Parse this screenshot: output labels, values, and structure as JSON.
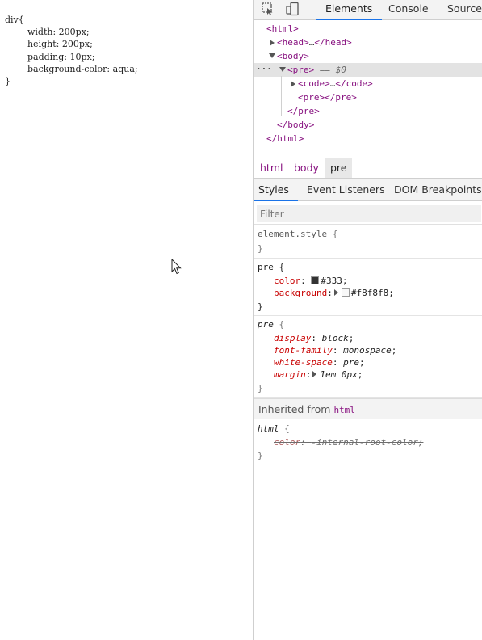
{
  "page": {
    "code_lines": [
      "div{",
      "        width: 200px;",
      "        height: 200px;",
      "        padding: 10px;",
      "        background-color: aqua;",
      "}"
    ]
  },
  "devtools": {
    "tabs": [
      {
        "label": "Elements",
        "active": true
      },
      {
        "label": "Console",
        "active": false
      },
      {
        "label": "Sources",
        "active": false
      }
    ],
    "dom_tree": {
      "html_open": "<html>",
      "head_open": "<head>",
      "head_ellipsis": "…",
      "head_close": "</head>",
      "body_open": "<body>",
      "pre_open": "<pre>",
      "selected_marker": "== $0",
      "code_open": "<code>",
      "code_ellipsis": "…",
      "code_close": "</code>",
      "inner_pre_open": "<pre>",
      "inner_pre_close": "</pre>",
      "pre_close": "</pre>",
      "body_close": "</body>",
      "html_close": "</html>"
    },
    "breadcrumb": [
      {
        "label": "html",
        "active": false
      },
      {
        "label": "body",
        "active": false
      },
      {
        "label": "pre",
        "active": true
      }
    ],
    "style_tabs": [
      {
        "label": "Styles",
        "active": true
      },
      {
        "label": "Event Listeners",
        "active": false
      },
      {
        "label": "DOM Breakpoints",
        "active": false
      }
    ],
    "filter_placeholder": "Filter",
    "rules": {
      "element_style": {
        "selector": "element.style",
        "open": "{",
        "close": "}"
      },
      "pre_author": {
        "selector": "pre",
        "open": "{",
        "close": "}",
        "color_prop": "color",
        "color_val": "#333",
        "color_swatch": "#333333",
        "background_prop": "background",
        "background_val": "#f8f8f8",
        "background_swatch": "#f8f8f8"
      },
      "pre_ua": {
        "selector": "pre",
        "open": "{",
        "close": "}",
        "props": [
          {
            "prop": "display",
            "val": "block"
          },
          {
            "prop": "font-family",
            "val": "monospace"
          },
          {
            "prop": "white-space",
            "val": "pre"
          },
          {
            "prop": "margin",
            "val": "1em 0px"
          }
        ]
      },
      "inherited_label": "Inherited from",
      "inherited_tag": "html",
      "html_ua": {
        "selector": "html",
        "open": "{",
        "close": "}",
        "prop": "color",
        "val": "-internal-root-color"
      }
    },
    "colors": {
      "tag": "#881280",
      "property": "#c80000",
      "accent": "#1a73e8",
      "selected_row": "#e3e3e3"
    }
  }
}
